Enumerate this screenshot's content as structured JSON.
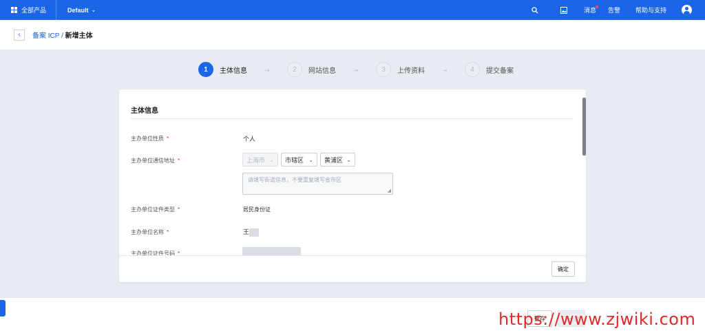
{
  "topbar": {
    "all_products": "全部产品",
    "region": "Default",
    "messages": "消息",
    "alerts": "告警",
    "help": "帮助与支持"
  },
  "breadcrumb": {
    "parent": "备案 ICP",
    "separator": "/",
    "current": "新增主体"
  },
  "steps": [
    {
      "num": "1",
      "label": "主体信息"
    },
    {
      "num": "2",
      "label": "网站信息"
    },
    {
      "num": "3",
      "label": "上传资料"
    },
    {
      "num": "4",
      "label": "提交备案"
    }
  ],
  "form": {
    "section_title": "主体信息",
    "fields": {
      "org_type_label": "主办单位性质",
      "org_type_value": "个人",
      "address_label": "主办单位通信地址",
      "province": "上海市",
      "district": "市辖区",
      "county": "黄浦区",
      "address_placeholder": "请填写街道信息，不要重复填写省市区",
      "cert_type_label": "主办单位证件类型",
      "cert_type_value": "居民身份证",
      "name_label": "主办单位名称",
      "name_value": "王",
      "cert_no_label": "主办单位证件号码"
    },
    "required_mark": "*",
    "confirm_button": "确定"
  },
  "footer": {
    "save_button": "暂存",
    "next_button": "下一步"
  },
  "watermark": "https://www.zjwiki.com",
  "colors": {
    "primary": "#1a66e6",
    "required": "#f5222d",
    "watermark": "#e02a2a"
  }
}
